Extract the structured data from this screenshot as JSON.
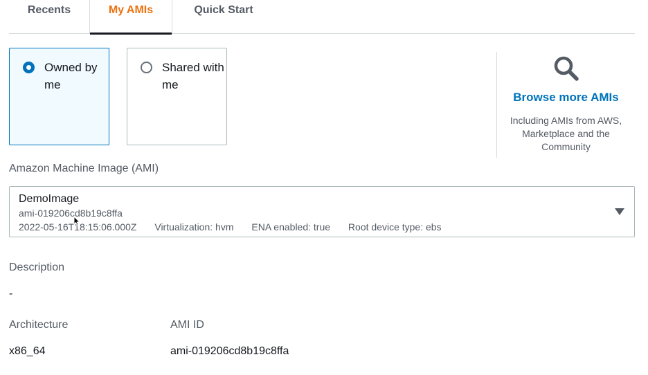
{
  "tabs": [
    {
      "label": "Recents"
    },
    {
      "label": "My AMIs",
      "active": true
    },
    {
      "label": "Quick Start"
    }
  ],
  "source_options": [
    {
      "label": "Owned by me",
      "selected": true
    },
    {
      "label": "Shared with me",
      "selected": false
    }
  ],
  "browse": {
    "icon": "search-icon",
    "link_label": "Browse more AMIs",
    "description": "Including AMIs from AWS, Marketplace and the Community"
  },
  "ami": {
    "label": "Amazon Machine Image (AMI)",
    "selected": {
      "name": "DemoImage",
      "id": "ami-019206cd8b19c8ffa",
      "created": "2022-05-16T18:15:06.000Z",
      "virtualization": "Virtualization: hvm",
      "ena": "ENA enabled: true",
      "root_device": "Root device type: ebs"
    }
  },
  "details": {
    "description_label": "Description",
    "description_value": "-",
    "architecture_label": "Architecture",
    "architecture_value": "x86_64",
    "ami_id_label": "AMI ID",
    "ami_id_value": "ami-019206cd8b19c8ffa"
  },
  "colors": {
    "accent": "#0073bb",
    "active_tab": "#ec7211"
  }
}
